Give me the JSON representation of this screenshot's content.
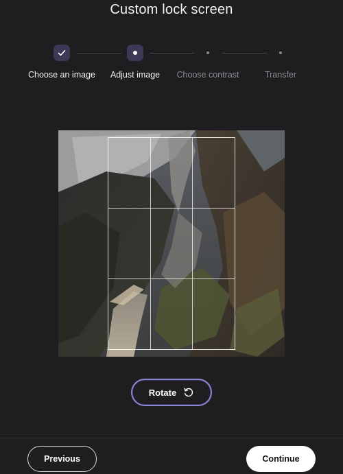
{
  "title": "Custom lock screen",
  "stepper": {
    "steps": [
      {
        "label": "Choose an image",
        "state": "done"
      },
      {
        "label": "Adjust image",
        "state": "active"
      },
      {
        "label": "Choose contrast",
        "state": "pending"
      },
      {
        "label": "Transfer",
        "state": "pending"
      }
    ]
  },
  "editor": {
    "rotate_label": "Rotate",
    "crop_grid": "3x3"
  },
  "footer": {
    "previous_label": "Previous",
    "continue_label": "Continue"
  },
  "colors": {
    "background": "#1e1e20",
    "accent": "#8d88d8",
    "step_fill": "#3b3955"
  },
  "icons": {
    "check": "checkmark-icon",
    "rotate": "rotate-ccw-icon"
  }
}
